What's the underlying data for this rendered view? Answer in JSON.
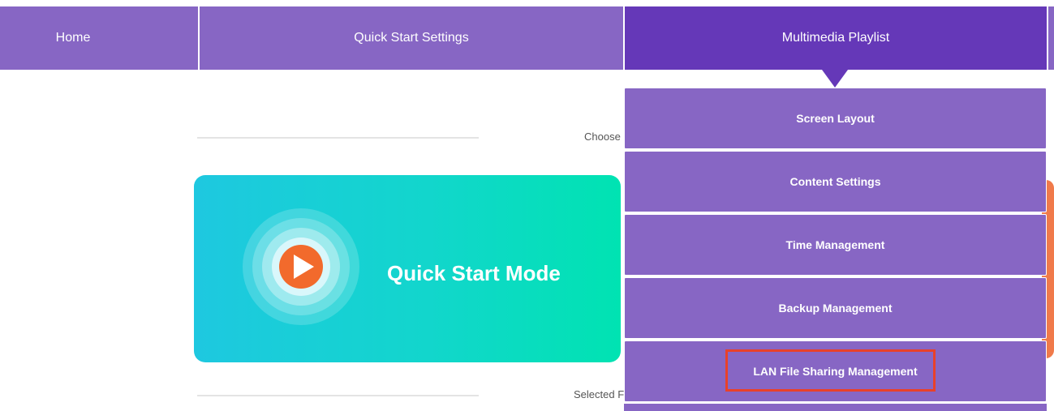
{
  "nav": {
    "home": "Home",
    "quick_start": "Quick Start Settings",
    "multimedia": "Multimedia Playlist"
  },
  "content": {
    "choose_label": "Choose",
    "selected_label": "Selected F",
    "quick_start_card": "Quick Start Mode"
  },
  "dropdown": {
    "items": [
      {
        "label": "Screen Layout"
      },
      {
        "label": "Content Settings"
      },
      {
        "label": "Time Management"
      },
      {
        "label": "Backup Management"
      },
      {
        "label": "LAN File Sharing Management"
      }
    ]
  },
  "colors": {
    "nav_bg": "#8766c4",
    "nav_active_bg": "#6538b8",
    "highlight": "#e8412a",
    "card_gradient_start": "#1ec8e0",
    "card_gradient_end": "#00e3b2",
    "play_button": "#f26a2c"
  }
}
